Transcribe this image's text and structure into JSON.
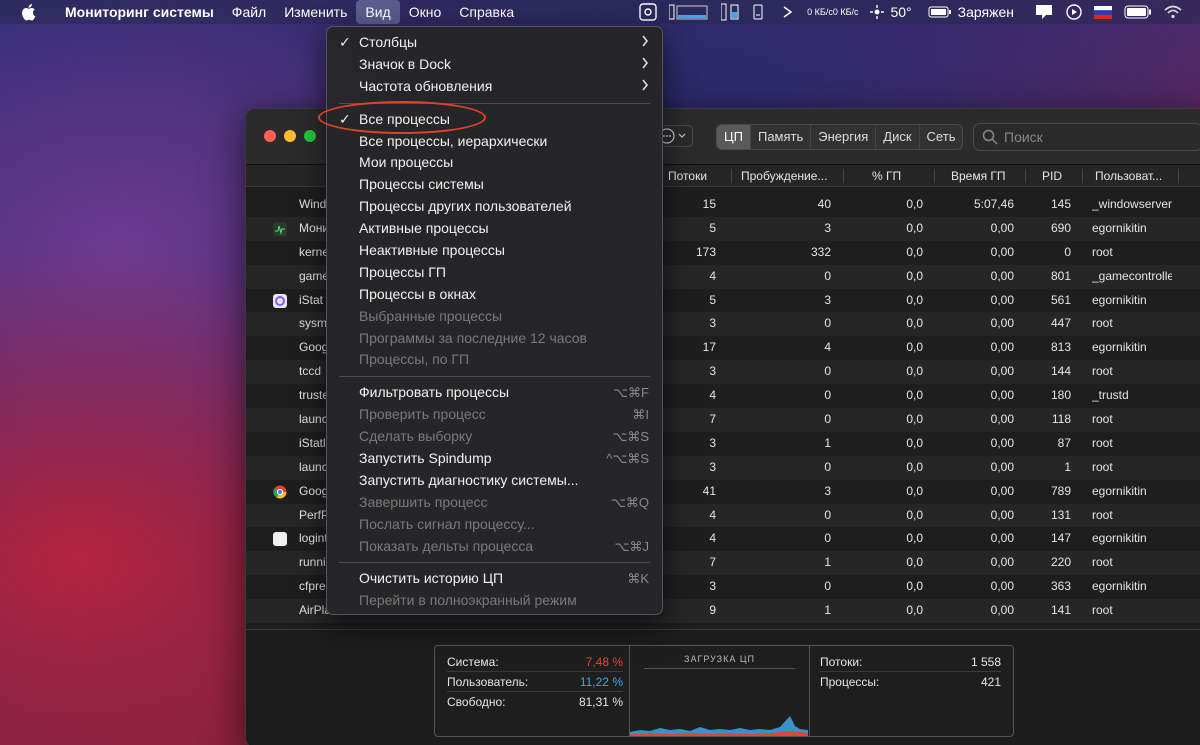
{
  "menubar": {
    "app_name": "Мониторинг системы",
    "items": [
      "Файл",
      "Изменить",
      "Вид",
      "Окно",
      "Справка"
    ],
    "active_item": "Вид",
    "status": {
      "net_up": "0 КБ/с",
      "net_down": "0 КБ/с",
      "temperature": "50°",
      "battery_status": "Заряжен"
    }
  },
  "window": {
    "tabs": [
      "ЦП",
      "Память",
      "Энергия",
      "Диск",
      "Сеть"
    ],
    "selected_tab": "ЦП",
    "search_placeholder": "Поиск",
    "columns": [
      "Потоки",
      "Пробуждение...",
      "% ГП",
      "Время ГП",
      "PID",
      "Пользоват..."
    ],
    "rows": [
      {
        "name": "Wind",
        "threads": "15",
        "wake": "40",
        "gpu": "0,0",
        "gpu_time": "5:07,46",
        "pid": "145",
        "user": "_windowserver",
        "icon": "none"
      },
      {
        "name": "Мони",
        "threads": "5",
        "wake": "3",
        "gpu": "0,0",
        "gpu_time": "0,00",
        "pid": "690",
        "user": "egornikitin",
        "icon": "activity-monitor"
      },
      {
        "name": "kerne",
        "threads": "173",
        "wake": "332",
        "gpu": "0,0",
        "gpu_time": "0,00",
        "pid": "0",
        "user": "root",
        "icon": "none"
      },
      {
        "name": "game",
        "threads": "4",
        "wake": "0",
        "gpu": "0,0",
        "gpu_time": "0,00",
        "pid": "801",
        "user": "_gamecontrolle",
        "icon": "none"
      },
      {
        "name": "iStat",
        "threads": "5",
        "wake": "3",
        "gpu": "0,0",
        "gpu_time": "0,00",
        "pid": "561",
        "user": "egornikitin",
        "icon": "istat"
      },
      {
        "name": "sysm",
        "threads": "3",
        "wake": "0",
        "gpu": "0,0",
        "gpu_time": "0,00",
        "pid": "447",
        "user": "root",
        "icon": "none"
      },
      {
        "name": "Goog",
        "threads": "17",
        "wake": "4",
        "gpu": "0,0",
        "gpu_time": "0,00",
        "pid": "813",
        "user": "egornikitin",
        "icon": "none"
      },
      {
        "name": "tccd",
        "threads": "3",
        "wake": "0",
        "gpu": "0,0",
        "gpu_time": "0,00",
        "pid": "144",
        "user": "root",
        "icon": "none"
      },
      {
        "name": "truste",
        "threads": "4",
        "wake": "0",
        "gpu": "0,0",
        "gpu_time": "0,00",
        "pid": "180",
        "user": "_trustd",
        "icon": "none"
      },
      {
        "name": "launc",
        "threads": "7",
        "wake": "0",
        "gpu": "0,0",
        "gpu_time": "0,00",
        "pid": "118",
        "user": "root",
        "icon": "none"
      },
      {
        "name": "iStatl",
        "threads": "3",
        "wake": "1",
        "gpu": "0,0",
        "gpu_time": "0,00",
        "pid": "87",
        "user": "root",
        "icon": "none"
      },
      {
        "name": "launc",
        "threads": "3",
        "wake": "0",
        "gpu": "0,0",
        "gpu_time": "0,00",
        "pid": "1",
        "user": "root",
        "icon": "none"
      },
      {
        "name": "Goog",
        "threads": "41",
        "wake": "3",
        "gpu": "0,0",
        "gpu_time": "0,00",
        "pid": "789",
        "user": "egornikitin",
        "icon": "chrome"
      },
      {
        "name": "PerfP",
        "threads": "4",
        "wake": "0",
        "gpu": "0,0",
        "gpu_time": "0,00",
        "pid": "131",
        "user": "root",
        "icon": "none"
      },
      {
        "name": "logint",
        "threads": "4",
        "wake": "0",
        "gpu": "0,0",
        "gpu_time": "0,00",
        "pid": "147",
        "user": "egornikitin",
        "icon": "blank"
      },
      {
        "name": "runni",
        "threads": "7",
        "wake": "1",
        "gpu": "0,0",
        "gpu_time": "0,00",
        "pid": "220",
        "user": "root",
        "icon": "none"
      },
      {
        "name": "cfpre",
        "threads": "3",
        "wake": "0",
        "gpu": "0,0",
        "gpu_time": "0,00",
        "pid": "363",
        "user": "egornikitin",
        "icon": "none"
      },
      {
        "name": "AirPlay",
        "threads": "9",
        "wake": "1",
        "gpu": "0,0",
        "gpu_time": "0,00",
        "pid": "141",
        "user": "root",
        "icon": "none"
      }
    ],
    "summary": {
      "system_label": "Система:",
      "system_value": "7,48 %",
      "user_label": "Пользователь:",
      "user_value": "11,22 %",
      "idle_label": "Свободно:",
      "idle_value": "81,31 %",
      "chart_title": "ЗАГРУЗКА ЦП",
      "threads_label": "Потоки:",
      "threads_value": "1 558",
      "processes_label": "Процессы:",
      "processes_value": "421",
      "colors": {
        "system": "#e0453a",
        "user": "#3ea6e8"
      }
    }
  },
  "menu": {
    "groups": [
      [
        {
          "label": "Столбцы",
          "checked": true,
          "submenu": true,
          "disabled": false,
          "shortcut": ""
        },
        {
          "label": "Значок в Dock",
          "checked": false,
          "submenu": true,
          "disabled": false,
          "shortcut": ""
        },
        {
          "label": "Частота обновления",
          "checked": false,
          "submenu": true,
          "disabled": false,
          "shortcut": ""
        }
      ],
      [
        {
          "label": "Все процессы",
          "checked": true,
          "submenu": false,
          "disabled": false,
          "shortcut": ""
        },
        {
          "label": "Все процессы, иерархически",
          "checked": false,
          "submenu": false,
          "disabled": false,
          "shortcut": ""
        },
        {
          "label": "Мои процессы",
          "checked": false,
          "submenu": false,
          "disabled": false,
          "shortcut": ""
        },
        {
          "label": "Процессы системы",
          "checked": false,
          "submenu": false,
          "disabled": false,
          "shortcut": ""
        },
        {
          "label": "Процессы других пользователей",
          "checked": false,
          "submenu": false,
          "disabled": false,
          "shortcut": ""
        },
        {
          "label": "Активные процессы",
          "checked": false,
          "submenu": false,
          "disabled": false,
          "shortcut": ""
        },
        {
          "label": "Неактивные процессы",
          "checked": false,
          "submenu": false,
          "disabled": false,
          "shortcut": ""
        },
        {
          "label": "Процессы ГП",
          "checked": false,
          "submenu": false,
          "disabled": false,
          "shortcut": ""
        },
        {
          "label": "Процессы в окнах",
          "checked": false,
          "submenu": false,
          "disabled": false,
          "shortcut": ""
        },
        {
          "label": "Выбранные процессы",
          "checked": false,
          "submenu": false,
          "disabled": true,
          "shortcut": ""
        },
        {
          "label": "Программы за последние 12 часов",
          "checked": false,
          "submenu": false,
          "disabled": true,
          "shortcut": ""
        },
        {
          "label": "Процессы, по ГП",
          "checked": false,
          "submenu": false,
          "disabled": true,
          "shortcut": ""
        }
      ],
      [
        {
          "label": "Фильтровать процессы",
          "checked": false,
          "submenu": false,
          "disabled": false,
          "shortcut": "⌥⌘F"
        },
        {
          "label": "Проверить процесс",
          "checked": false,
          "submenu": false,
          "disabled": true,
          "shortcut": "⌘I"
        },
        {
          "label": "Сделать выборку",
          "checked": false,
          "submenu": false,
          "disabled": true,
          "shortcut": "⌥⌘S"
        },
        {
          "label": "Запустить Spindump",
          "checked": false,
          "submenu": false,
          "disabled": false,
          "shortcut": "^⌥⌘S"
        },
        {
          "label": "Запустить диагностику системы...",
          "checked": false,
          "submenu": false,
          "disabled": false,
          "shortcut": ""
        },
        {
          "label": "Завершить процесс",
          "checked": false,
          "submenu": false,
          "disabled": true,
          "shortcut": "⌥⌘Q"
        },
        {
          "label": "Послать сигнал процессу...",
          "checked": false,
          "submenu": false,
          "disabled": true,
          "shortcut": ""
        },
        {
          "label": "Показать дельты процесса",
          "checked": false,
          "submenu": false,
          "disabled": true,
          "shortcut": "⌥⌘J"
        }
      ],
      [
        {
          "label": "Очистить историю ЦП",
          "checked": false,
          "submenu": false,
          "disabled": false,
          "shortcut": "⌘K"
        },
        {
          "label": "Перейти в полноэкранный режим",
          "checked": false,
          "submenu": false,
          "disabled": true,
          "shortcut": ""
        }
      ]
    ]
  }
}
